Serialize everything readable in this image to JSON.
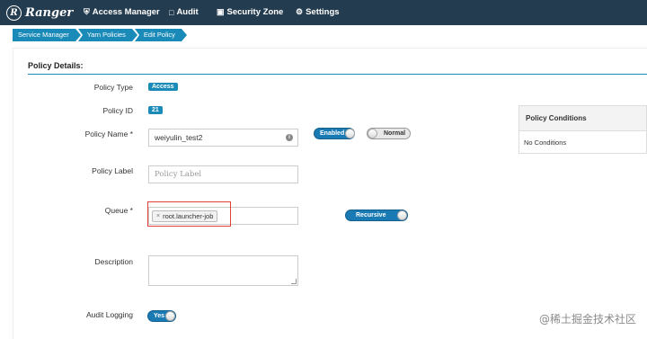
{
  "navbar": {
    "brand": "Ranger",
    "brand_logo_letter": "R",
    "items": [
      {
        "label": "Access Manager",
        "icon": "shield-icon"
      },
      {
        "label": "Audit",
        "icon": "file-icon"
      },
      {
        "label": "Security Zone",
        "icon": "zone-icon"
      },
      {
        "label": "Settings",
        "icon": "gear-icon"
      }
    ]
  },
  "breadcrumb": [
    "Service Manager",
    "Yarn Policies",
    "Edit Policy"
  ],
  "section": {
    "title": "Policy Details:"
  },
  "form": {
    "policy_type": {
      "label": "Policy Type",
      "value": "Access"
    },
    "policy_id": {
      "label": "Policy ID",
      "value": "21"
    },
    "policy_name": {
      "label": "Policy Name *",
      "value": "weiyulin_test2",
      "enabled_toggle": "Enabled",
      "normal_toggle": "Normal"
    },
    "policy_label": {
      "label": "Policy Label",
      "placeholder": "Policy Label"
    },
    "queue": {
      "label": "Queue *",
      "tag_remove": "×",
      "tag_value": "root.launcher-job",
      "recursive_toggle": "Recursive"
    },
    "description": {
      "label": "Description"
    },
    "audit_logging": {
      "label": "Audit Logging",
      "value": "Yes"
    }
  },
  "policy_conditions": {
    "header": "Policy Conditions",
    "body": "No Conditions"
  },
  "watermark": "@稀土掘金技术社区",
  "colors": {
    "navbar": "#243c4f",
    "accent": "#1a8bb8",
    "highlight": "#e0403a"
  }
}
